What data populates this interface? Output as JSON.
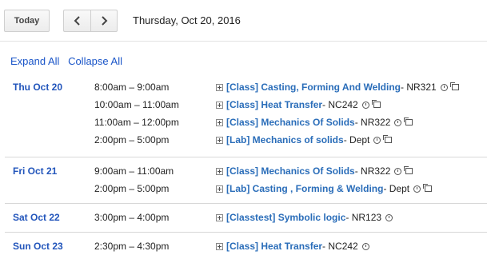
{
  "toolbar": {
    "today_label": "Today",
    "prev_icon": "chevron-left-icon",
    "next_icon": "chevron-right-icon",
    "current_date": "Thursday, Oct 20, 2016"
  },
  "links": {
    "expand_all": "Expand All",
    "collapse_all": "Collapse All"
  },
  "colors": {
    "day_label": "#2255bb",
    "event_link": "#2a6db9",
    "link": "#1a55c8"
  },
  "days": [
    {
      "label": "Thu Oct 20",
      "events": [
        {
          "time": "8:00am – 9:00am",
          "title": "[Class] Casting, Forming And Welding",
          "location": " - NR321",
          "copy": true
        },
        {
          "time": "10:00am – 11:00am",
          "title": "[Class] Heat Transfer",
          "location": " - NC242",
          "copy": true
        },
        {
          "time": "11:00am – 12:00pm",
          "title": "[Class] Mechanics Of Solids",
          "location": " - NR322",
          "copy": true
        },
        {
          "time": "2:00pm – 5:00pm",
          "title": "[Lab] Mechanics of solids",
          "location": " - Dept",
          "copy": true
        }
      ]
    },
    {
      "label": "Fri Oct 21",
      "events": [
        {
          "time": "9:00am – 11:00am",
          "title": "[Class] Mechanics Of Solids",
          "location": " - NR322",
          "copy": true
        },
        {
          "time": "2:00pm – 5:00pm",
          "title": "[Lab] Casting , Forming & Welding",
          "location": " - Dept",
          "copy": true
        }
      ]
    },
    {
      "label": "Sat Oct 22",
      "events": [
        {
          "time": "3:00pm – 4:00pm",
          "title": "[Classtest] Symbolic logic",
          "location": " - NR123",
          "copy": false
        }
      ]
    },
    {
      "label": "Sun Oct 23",
      "events": [
        {
          "time": "2:30pm – 4:30pm",
          "title": "[Class] Heat Transfer",
          "location": " - NC242",
          "copy": false
        }
      ]
    }
  ]
}
